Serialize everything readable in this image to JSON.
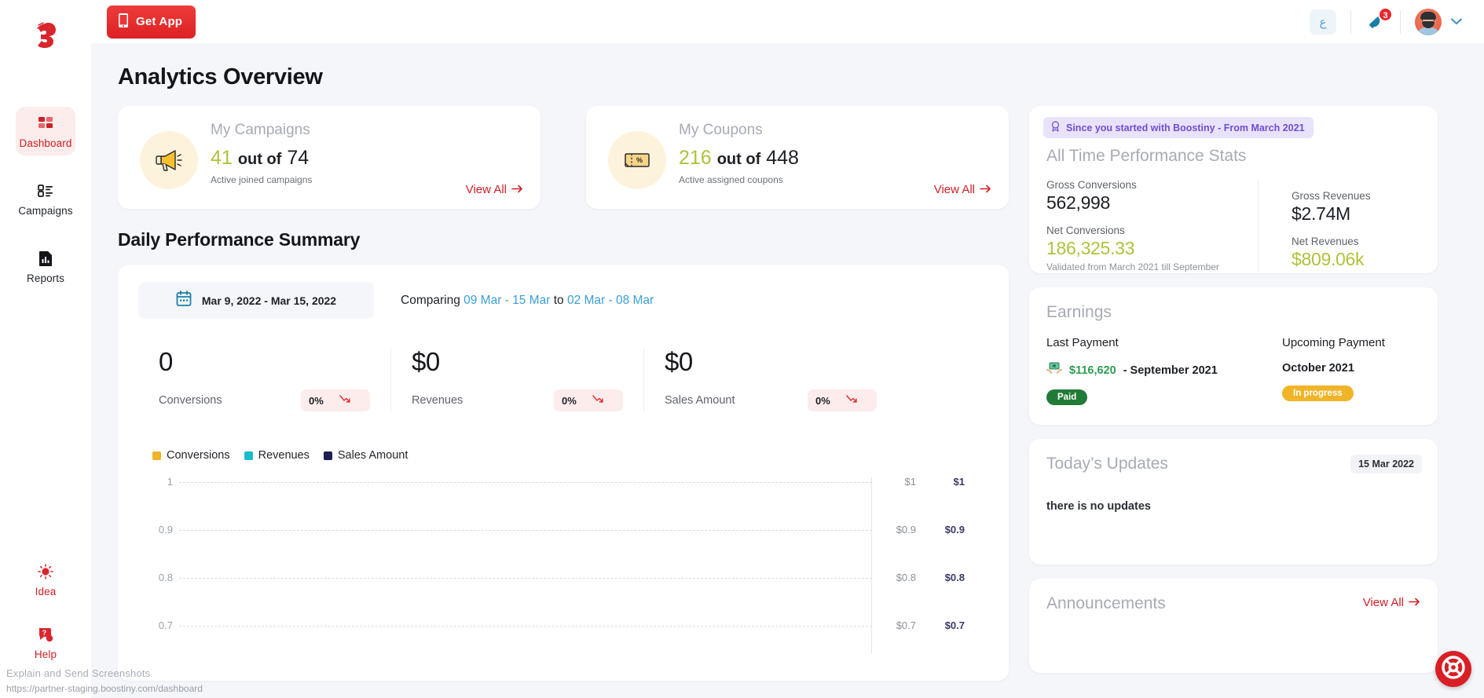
{
  "sidebar": {
    "logo": "boostiny-logo",
    "items": [
      {
        "label": "Dashboard",
        "icon": "grid-icon",
        "active": true
      },
      {
        "label": "Campaigns",
        "icon": "list-icon",
        "active": false
      },
      {
        "label": "Reports",
        "icon": "report-icon",
        "active": false
      }
    ],
    "bottom_items": [
      {
        "label": "Idea",
        "icon": "lightbulb-icon"
      },
      {
        "label": "Help",
        "icon": "help-chat-icon"
      }
    ]
  },
  "topbar": {
    "get_app_label": "Get App",
    "get_app_icon": "mobile-icon",
    "language_toggle": "ع",
    "notification_icon": "bell-icon",
    "notification_count": "3",
    "avatar_icon": "user-avatar",
    "chevron_icon": "chevron-down-icon"
  },
  "page": {
    "title": "Analytics Overview",
    "daily_section_title": "Daily Performance Summary"
  },
  "summary_cards": [
    {
      "title": "My Campaigns",
      "icon": "megaphone-icon",
      "active": "41",
      "middle": "out of",
      "total": "74",
      "subtitle": "Active joined campaigns",
      "view_all": "View All"
    },
    {
      "title": "My Coupons",
      "icon": "coupon-icon",
      "active": "216",
      "middle": "out of",
      "total": "448",
      "subtitle": "Active assigned coupons",
      "view_all": "View All"
    }
  ],
  "daily": {
    "date_picker": {
      "icon": "calendar-icon",
      "value": "Mar 9, 2022 - Mar 15, 2022"
    },
    "comparing_label": "Comparing",
    "comparing_from": "09 Mar - 15 Mar",
    "comparing_to_label": "to",
    "comparing_to": "02 Mar - 08 Mar",
    "metrics": [
      {
        "value": "0",
        "label": "Conversions",
        "pct": "0%",
        "trend": "down"
      },
      {
        "value": "$0",
        "label": "Revenues",
        "pct": "0%",
        "trend": "down"
      },
      {
        "value": "$0",
        "label": "Sales Amount",
        "pct": "0%",
        "trend": "down"
      }
    ]
  },
  "chart_data": {
    "type": "line",
    "title": "",
    "xlabel": "",
    "ylabel": "",
    "grid": true,
    "legend_position": "top-left",
    "legend": [
      {
        "name": "Conversions",
        "color": "#f0b429"
      },
      {
        "name": "Revenues",
        "color": "#18bccc"
      },
      {
        "name": "Sales Amount",
        "color": "#211e53"
      }
    ],
    "series": [
      {
        "name": "Conversions",
        "color": "#f0b429",
        "values": []
      },
      {
        "name": "Revenues",
        "color": "#18bccc",
        "values": []
      },
      {
        "name": "Sales Amount",
        "color": "#211e53",
        "values": []
      }
    ],
    "x": [],
    "axes": [
      {
        "id": "left",
        "name": "Conversions",
        "ticks": [
          "1",
          "0.9",
          "0.8",
          "0.7"
        ],
        "ylim": [
          0.7,
          1
        ]
      },
      {
        "id": "right1",
        "name": "Revenues",
        "ticks": [
          "$1",
          "$0.9",
          "$0.8",
          "$0.7"
        ],
        "ylim": [
          0.7,
          1
        ]
      },
      {
        "id": "right2",
        "name": "Sales Amount",
        "ticks": [
          "$1",
          "$0.9",
          "$0.8",
          "$0.7"
        ],
        "ylim": [
          0.7,
          1
        ]
      }
    ]
  },
  "stats": {
    "badge": "Since you started with Boostiny - From March 2021",
    "badge_icon": "award-icon",
    "title": "All Time Performance Stats",
    "gross_conversions_label": "Gross Conversions",
    "gross_conversions_value": "562,998",
    "net_conversions_label": "Net Conversions",
    "net_conversions_value": "186,325.33",
    "validated_note": "Validated from March 2021 till September",
    "gross_revenues_label": "Gross Revenues",
    "gross_revenues_value": "$2.74M",
    "net_revenues_label": "Net Revenues",
    "net_revenues_value": "$809.06k"
  },
  "earnings": {
    "title": "Earnings",
    "last_payment_label": "Last Payment",
    "last_payment_icon": "money-hands-icon",
    "last_payment_amount": "$116,620",
    "last_payment_period": "- September 2021",
    "last_payment_status": "Paid",
    "upcoming_payment_label": "Upcoming Payment",
    "upcoming_payment_period": "October 2021",
    "upcoming_payment_status": "In progress"
  },
  "updates": {
    "title": "Today’s Updates",
    "date": "15 Mar 2022",
    "body": "there is no updates"
  },
  "announcements": {
    "title": "Announcements",
    "view_all": "View All"
  },
  "overlay": {
    "extension_tip": "Explain and Send Screenshots",
    "status_url": "https://partner-staging.boostiny.com/dashboard",
    "fab_icon": "support-wheel-icon"
  },
  "colors": {
    "brand_red": "#cf2027",
    "accent_green": "#b2c13b",
    "paid_green": "#227a38",
    "progress_yellow": "#f0b429",
    "link_blue": "#3b9fd4",
    "purple_badge": "#6f4fd0"
  }
}
